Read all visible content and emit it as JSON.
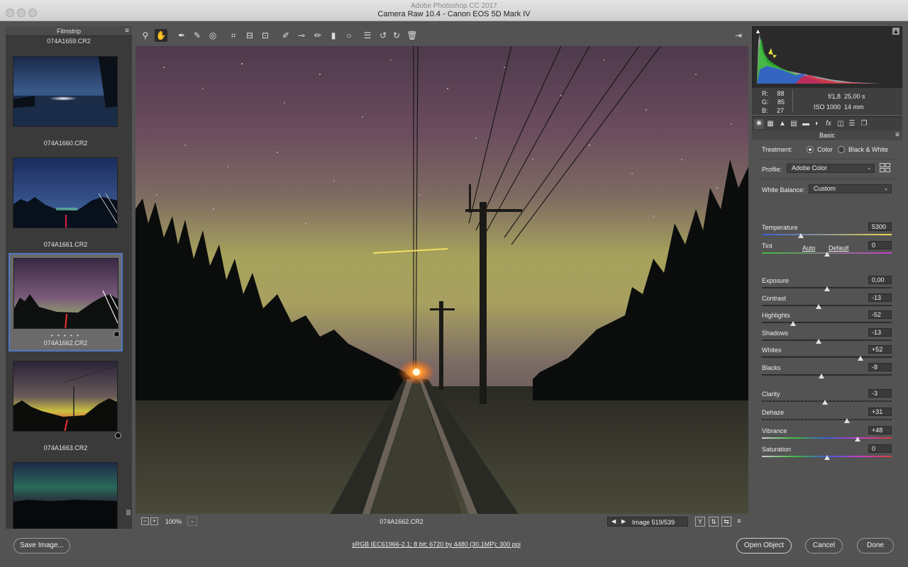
{
  "window": {
    "app_title": "Adobe Photoshop CC 2017",
    "title": "Camera Raw 10.4  -  Canon EOS 5D Mark IV"
  },
  "filmstrip": {
    "header": "Filmstrip",
    "top_name": "074A1659.CR2",
    "items": [
      {
        "name": "074A1660.CR2"
      },
      {
        "name": "074A1661.CR2"
      },
      {
        "name": "074A1662.CR2",
        "selected": true,
        "rating": "• • • • •"
      },
      {
        "name": "074A1663.CR2"
      },
      {
        "name": ""
      }
    ]
  },
  "toolbar": {
    "tools": [
      "zoom-icon",
      "hand-icon",
      "white-balance-icon",
      "color-sampler-icon",
      "targeted-adjustment-icon",
      "crop-icon",
      "straighten-icon",
      "transform-icon",
      "spot-removal-icon",
      "red-eye-icon",
      "adjustment-brush-icon",
      "graduated-filter-icon",
      "radial-filter-icon",
      "presets-list-icon",
      "rotate-left-icon",
      "rotate-right-icon",
      "trash-icon"
    ],
    "active_tool": "hand-icon"
  },
  "preview_footer": {
    "zoom": "100%",
    "filename": "074A1662.CR2",
    "image_counter": "Image 519/539",
    "view_buttons": [
      "Y",
      "⇅",
      "⇆",
      "≡"
    ]
  },
  "readout": {
    "r_label": "R:",
    "r_value": "88",
    "g_label": "G:",
    "g_value": "85",
    "b_label": "B:",
    "b_value": "27",
    "aperture": "f/1,8",
    "shutter": "25,00 s",
    "iso": "ISO 1000",
    "focal": "14 mm"
  },
  "basic": {
    "header": "Basic",
    "treatment_label": "Treatment:",
    "treatment_color": "Color",
    "treatment_bw": "Black & White",
    "profile_label": "Profile:",
    "profile_value": "Adobe Color",
    "wb_label": "White Balance:",
    "wb_value": "Custom",
    "auto_label": "Auto",
    "default_label": "Default",
    "sliders": [
      {
        "label": "Temperature",
        "value": "5300",
        "pos": 0.3
      },
      {
        "label": "Tint",
        "value": "0",
        "pos": 0.5
      },
      {
        "label": "Exposure",
        "value": "0,00",
        "pos": 0.5
      },
      {
        "label": "Contrast",
        "value": "-13",
        "pos": 0.435
      },
      {
        "label": "Highlights",
        "value": "-52",
        "pos": 0.24
      },
      {
        "label": "Shadows",
        "value": "-13",
        "pos": 0.435
      },
      {
        "label": "Whites",
        "value": "+52",
        "pos": 0.76
      },
      {
        "label": "Blacks",
        "value": "-8",
        "pos": 0.46
      },
      {
        "label": "Clarity",
        "value": "-3",
        "pos": 0.485
      },
      {
        "label": "Dehaze",
        "value": "+31",
        "pos": 0.655
      },
      {
        "label": "Vibrance",
        "value": "+48",
        "pos": 0.74
      },
      {
        "label": "Saturation",
        "value": "0",
        "pos": 0.5
      }
    ]
  },
  "footer": {
    "save_label": "Save Image...",
    "workflow_text": "sRGB IEC61966-2.1; 8 bit; 6720 by 4480 (30.1MP); 300 ppi",
    "open_label": "Open Object",
    "cancel_label": "Cancel",
    "done_label": "Done"
  },
  "colors": {
    "panel_bg": "#535353",
    "selection_border": "#4f78c4",
    "sky_top": "#5a3f52",
    "sky_glow": "#a9a863"
  }
}
